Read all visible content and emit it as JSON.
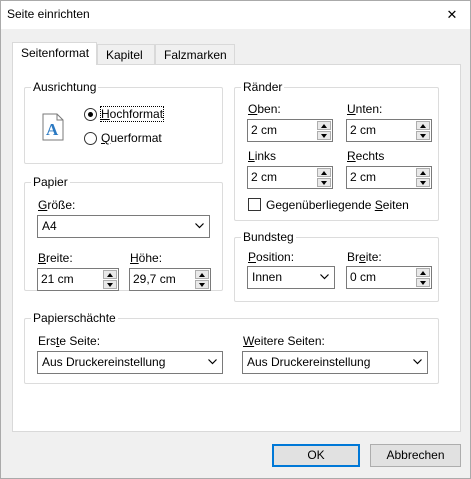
{
  "window": {
    "title": "Seite einrichten",
    "close_glyph": "✕"
  },
  "tabs": [
    {
      "label": "Seitenformat"
    },
    {
      "label": "Kapitel"
    },
    {
      "label": "Falzmarken"
    }
  ],
  "ausrichtung": {
    "legend": "Ausrichtung",
    "preview_glyph": "A",
    "hochformat_first": "H",
    "hochformat_rest": "ochformat",
    "querformat_first": "Q",
    "querformat_rest": "uerformat",
    "selected": "Hochformat"
  },
  "raender": {
    "legend": "Ränder",
    "oben_first": "O",
    "oben_rest": "ben:",
    "oben_value": "2 cm",
    "unten_first": "U",
    "unten_rest": "nten:",
    "unten_value": "2 cm",
    "links_first": "L",
    "links_rest": "inks",
    "links_value": "2 cm",
    "rechts_first": "R",
    "rechts_rest": "echts",
    "rechts_value": "2 cm",
    "gegen_pre": "Gegenüberliegende ",
    "gegen_u": "S",
    "gegen_post": "eiten",
    "gegen_checked": false
  },
  "papier": {
    "legend": "Papier",
    "groesse_first": "G",
    "groesse_rest": "röße:",
    "groesse_value": "A4",
    "breite_first": "B",
    "breite_rest": "reite:",
    "breite_value": "21 cm",
    "hoehe_first": "H",
    "hoehe_rest": "öhe:",
    "hoehe_value": "29,7 cm"
  },
  "bundsteg": {
    "legend": "Bundsteg",
    "position_first": "P",
    "position_rest": "osition:",
    "position_value": "Innen",
    "breite_pre": "Br",
    "breite_u": "e",
    "breite_post": "ite:",
    "breite_value": "0 cm"
  },
  "papierschaechte": {
    "legend": "Papierschächte",
    "erste_pre": "Ers",
    "erste_u": "t",
    "erste_post": "e Seite:",
    "erste_value": "Aus Druckereinstellung",
    "weitere_first": "W",
    "weitere_rest": "eitere Seiten:",
    "weitere_value": "Aus Druckereinstellung"
  },
  "buttons": {
    "ok": "OK",
    "cancel": "Abbrechen"
  },
  "colors": {
    "accent": "#0078d7",
    "preview_icon": "#2b79c2"
  }
}
